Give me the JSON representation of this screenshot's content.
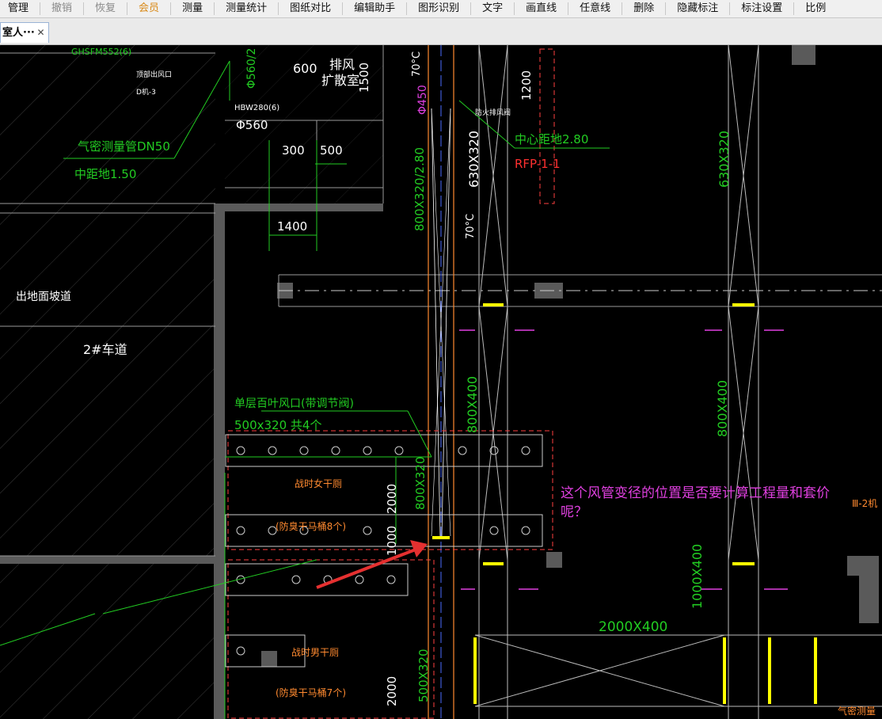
{
  "toolbar": {
    "items": [
      {
        "label": "管理",
        "style": "normal"
      },
      {
        "label": "撤销",
        "style": "dim"
      },
      {
        "label": "恢复",
        "style": "dim"
      },
      {
        "label": "会员",
        "style": "accent"
      },
      {
        "label": "测量",
        "style": "normal"
      },
      {
        "label": "测量统计",
        "style": "normal"
      },
      {
        "label": "图纸对比",
        "style": "normal"
      },
      {
        "label": "编辑助手",
        "style": "normal"
      },
      {
        "label": "图形识别",
        "style": "normal"
      },
      {
        "label": "文字",
        "style": "normal"
      },
      {
        "label": "画直线",
        "style": "normal"
      },
      {
        "label": "任意线",
        "style": "normal"
      },
      {
        "label": "删除",
        "style": "normal"
      },
      {
        "label": "隐藏标注",
        "style": "normal"
      },
      {
        "label": "标注设置",
        "style": "normal"
      },
      {
        "label": "比例",
        "style": "normal"
      }
    ]
  },
  "tab": {
    "label": "室人···",
    "close_icon": "close-icon"
  },
  "drawing": {
    "labels": {
      "top_code": "GHSFM552(6)",
      "small_a": "顶部出风口",
      "small_b": "D机-3",
      "phi560_top": "Φ560/2",
      "dim600": "600",
      "exhaust1": "排风",
      "exhaust2": "扩散室",
      "dim1500": "1500",
      "temp70_top": "70°C",
      "dim1200": "1200",
      "phi450": "Φ450",
      "hbw": "HBW280(6)",
      "phi560": "Φ560",
      "gas_pipe": "气密测量管DN50",
      "center150": "中距地1.50",
      "dim300": "300",
      "dim500": "500",
      "center280": "中心距地2.80",
      "rfp": "RFP-1-1",
      "fire_valve": "防火排风阀",
      "duct630_1": "630X320",
      "duct630_2": "630X320",
      "duct800_320_280": "800X320/2.80",
      "temp70": "70°C",
      "dim1400": "1400",
      "ramp": "出地面坡道",
      "lane": "2#车道",
      "louver1": "单层百叶风口(带调节阀)",
      "louver2": "500x320 共4个",
      "duct800_400_a": "800X400",
      "duct800_400_b": "800X400",
      "duct800_320": "800X320",
      "dim2000": "2000",
      "dim1000": "1000",
      "dry_toilet_w": "战时女干厕",
      "dry_toilet_w_sub": "(防臭干马桶8个)",
      "dry_toilet_m": "战时男干厕",
      "dry_toilet_m_sub": "(防臭干马桶7个)",
      "duct1000_400": "1000X400",
      "duct2000_400": "2000X400",
      "dim2000_b": "2000",
      "duct500_320": "500X320",
      "right_edge": "Ⅲ-2机",
      "bottom_right": "气密测量"
    }
  },
  "question": "这个风管变径的位置是否要计算工程量和套价呢？",
  "colors": {
    "canvas": "#000000",
    "green": "#22cc22",
    "white": "#ffffff",
    "orange": "#ff8a30",
    "red": "#ff3030",
    "yellow": "#ffff00",
    "magenta": "#e040e0",
    "blue": "#4a6cff",
    "gray": "#6a6a6a"
  }
}
